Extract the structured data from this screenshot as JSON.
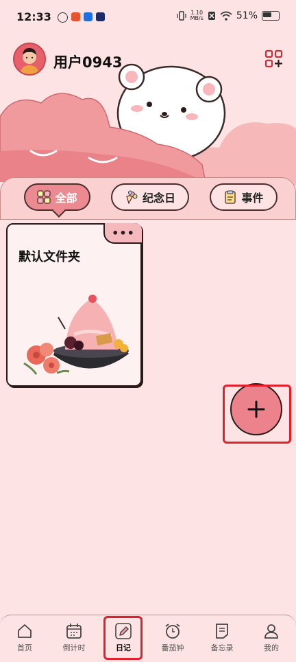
{
  "status_bar": {
    "time": "12:33",
    "net_speed_value": "1.10",
    "net_speed_unit": "MB/s",
    "battery": "51%"
  },
  "header": {
    "username": "用户0943",
    "grid_icon": "grid-add-icon"
  },
  "tabs": [
    {
      "label": "全部",
      "icon": "grid-icon",
      "active": true
    },
    {
      "label": "纪念日",
      "icon": "bouquet-icon",
      "active": false
    },
    {
      "label": "事件",
      "icon": "event-note-icon",
      "active": false
    }
  ],
  "folder_card": {
    "title": "默认文件夹",
    "more_label": "•••"
  },
  "fab": {
    "icon": "plus-icon",
    "symbol": "+"
  },
  "bottom_nav": [
    {
      "label": "首页",
      "icon": "home-icon",
      "active": false
    },
    {
      "label": "倒计时",
      "icon": "calendar-icon",
      "active": false
    },
    {
      "label": "日记",
      "icon": "pencil-icon",
      "active": true
    },
    {
      "label": "番茄钟",
      "icon": "alarm-clock-icon",
      "active": false
    },
    {
      "label": "备忘录",
      "icon": "memo-icon",
      "active": false
    },
    {
      "label": "我的",
      "icon": "user-icon",
      "active": false
    }
  ],
  "colors": {
    "background": "#fde3e3",
    "accent": "#ec8a92",
    "highlight_box": "#e0202a"
  }
}
